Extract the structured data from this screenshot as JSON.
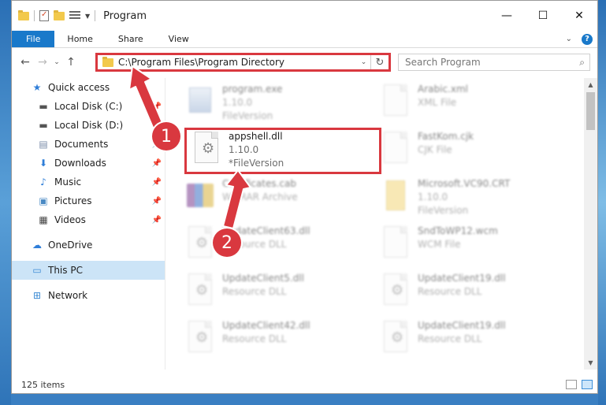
{
  "window": {
    "title": "Program",
    "minimize_icon": "minimize-icon",
    "maximize_icon": "maximize-icon",
    "close_icon": "close-icon"
  },
  "ribbon": {
    "tabs": [
      {
        "label": "File"
      },
      {
        "label": "Home"
      },
      {
        "label": "Share"
      },
      {
        "label": "View"
      }
    ]
  },
  "address": {
    "path": "C:\\Program Files\\Program Directory",
    "search_placeholder": "Search Program"
  },
  "nav": {
    "items": [
      {
        "label": "Quick access"
      },
      {
        "label": "Local Disk (C:)"
      },
      {
        "label": "Local Disk (D:)"
      },
      {
        "label": "Documents"
      },
      {
        "label": "Downloads"
      },
      {
        "label": "Music"
      },
      {
        "label": "Pictures"
      },
      {
        "label": "Videos"
      },
      {
        "label": "OneDrive"
      },
      {
        "label": "This PC"
      },
      {
        "label": "Network"
      }
    ]
  },
  "files": [
    {
      "name": "program.exe",
      "line1": "1.10.0",
      "line2": "FileVersion"
    },
    {
      "name": "Arabic.xml",
      "line1": "XML File"
    },
    {
      "name": "appshell.dll",
      "line1": "1.10.0",
      "line2": "*FileVersion"
    },
    {
      "name": "FastKom.cjk",
      "line1": "CJK File"
    },
    {
      "name": "Certificates.cab",
      "line1": "WinRAR Archive"
    },
    {
      "name": "Microsoft.VC90.CRT",
      "line1": "1.10.0",
      "line2": "FileVersion"
    },
    {
      "name": "UpdateClient63.dll",
      "line1": "Resource DLL"
    },
    {
      "name": "SndToWP12.wcm",
      "line1": "WCM File"
    },
    {
      "name": "UpdateClient5.dll",
      "line1": "Resource DLL"
    },
    {
      "name": "UpdateClient19.dll",
      "line1": "Resource DLL"
    },
    {
      "name": "UpdateClient42.dll",
      "line1": "Resource DLL"
    },
    {
      "name": "UpdateClient19.dll",
      "line1": "Resource DLL"
    }
  ],
  "status": {
    "items": "125 items"
  },
  "annotations": {
    "step1": "1",
    "step2": "2",
    "color": "#d9383f"
  }
}
